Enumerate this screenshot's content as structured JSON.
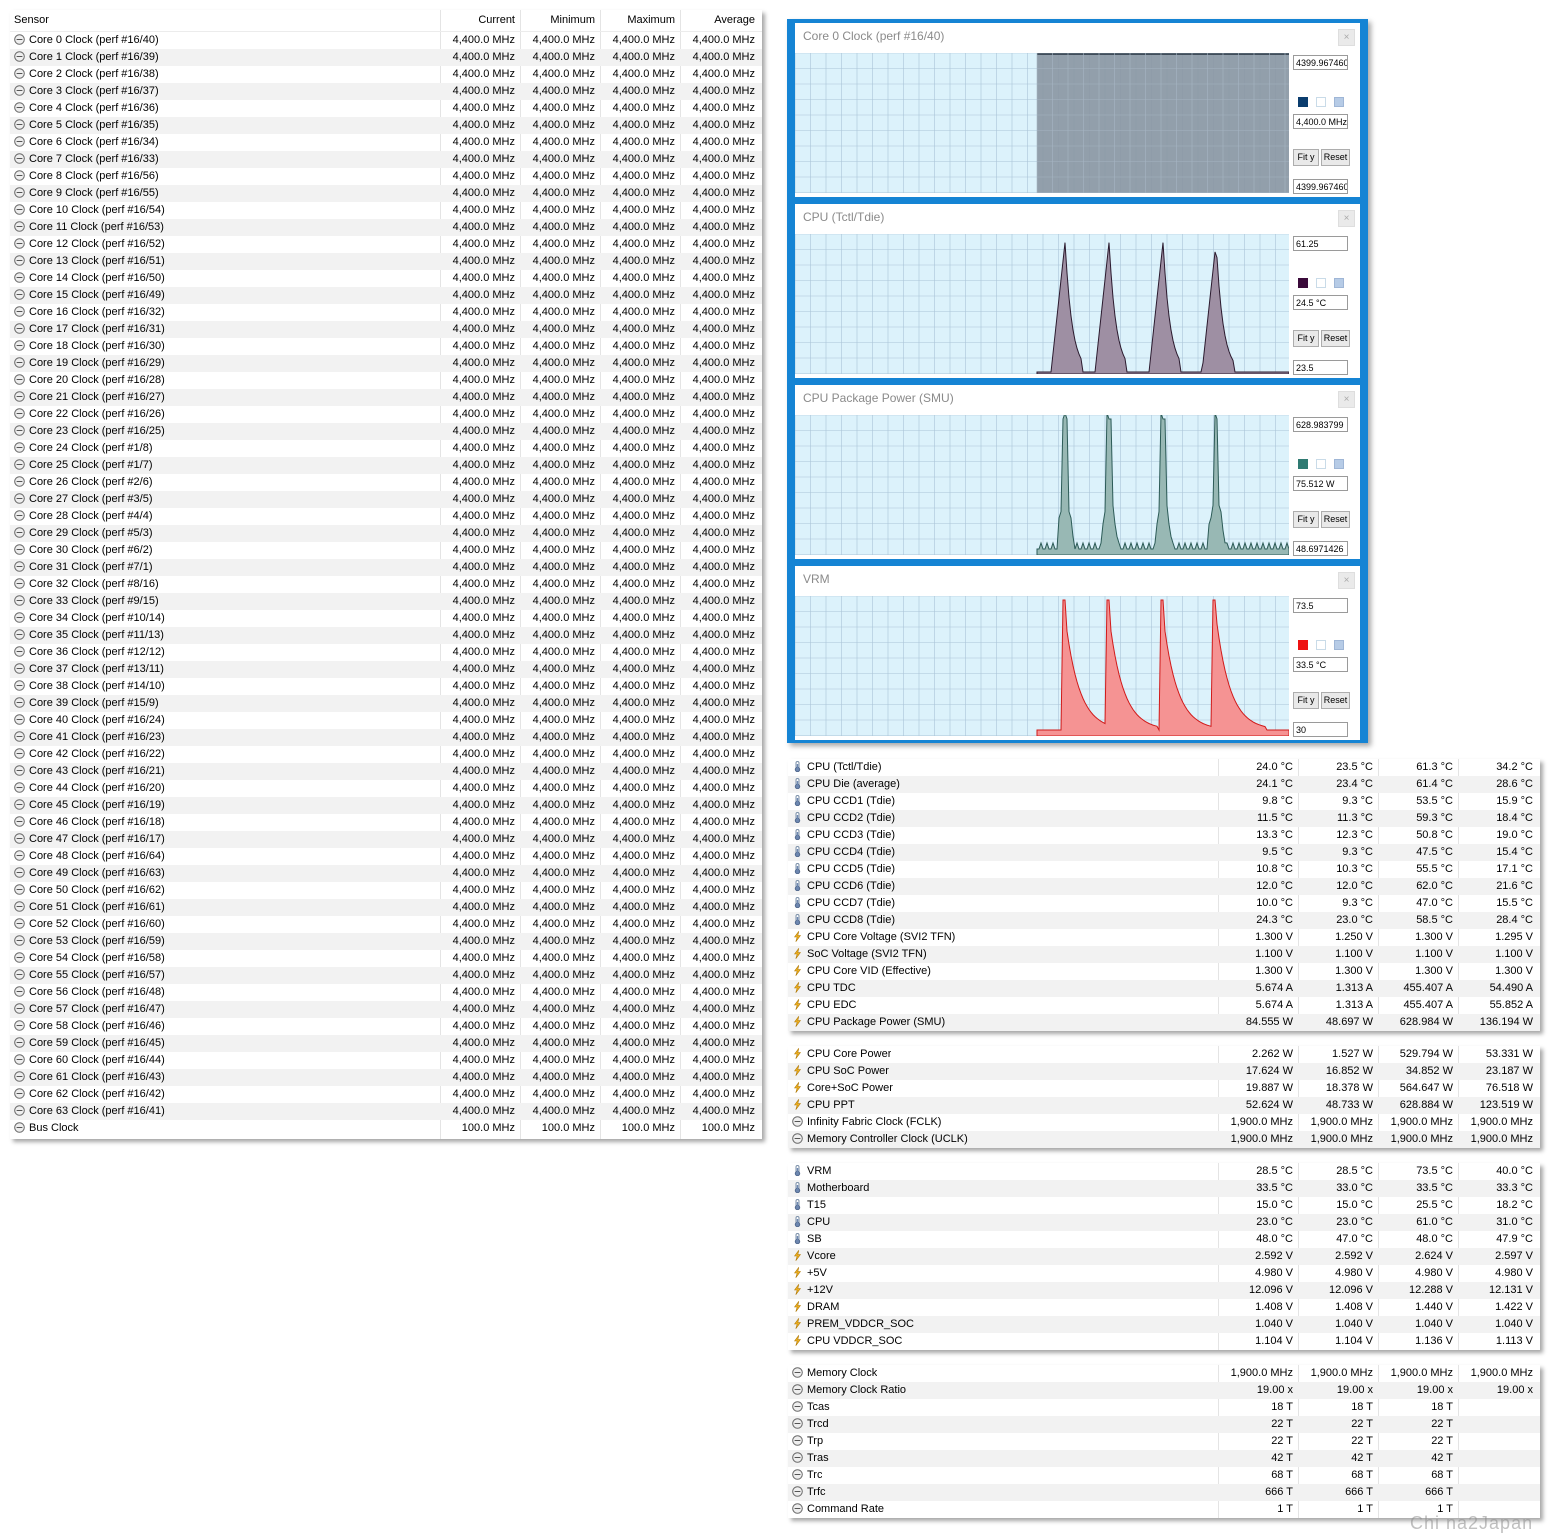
{
  "left_table": {
    "headers": [
      "Sensor",
      "Current",
      "Minimum",
      "Maximum",
      "Average"
    ],
    "rows": [
      [
        "Core 0 Clock (perf #16/40)",
        "4,400.0 MHz",
        "4,400.0 MHz",
        "4,400.0 MHz",
        "4,400.0 MHz"
      ],
      [
        "Core 1 Clock (perf #16/39)",
        "4,400.0 MHz",
        "4,400.0 MHz",
        "4,400.0 MHz",
        "4,400.0 MHz"
      ],
      [
        "Core 2 Clock (perf #16/38)",
        "4,400.0 MHz",
        "4,400.0 MHz",
        "4,400.0 MHz",
        "4,400.0 MHz"
      ],
      [
        "Core 3 Clock (perf #16/37)",
        "4,400.0 MHz",
        "4,400.0 MHz",
        "4,400.0 MHz",
        "4,400.0 MHz"
      ],
      [
        "Core 4 Clock (perf #16/36)",
        "4,400.0 MHz",
        "4,400.0 MHz",
        "4,400.0 MHz",
        "4,400.0 MHz"
      ],
      [
        "Core 5 Clock (perf #16/35)",
        "4,400.0 MHz",
        "4,400.0 MHz",
        "4,400.0 MHz",
        "4,400.0 MHz"
      ],
      [
        "Core 6 Clock (perf #16/34)",
        "4,400.0 MHz",
        "4,400.0 MHz",
        "4,400.0 MHz",
        "4,400.0 MHz"
      ],
      [
        "Core 7 Clock (perf #16/33)",
        "4,400.0 MHz",
        "4,400.0 MHz",
        "4,400.0 MHz",
        "4,400.0 MHz"
      ],
      [
        "Core 8 Clock (perf #16/56)",
        "4,400.0 MHz",
        "4,400.0 MHz",
        "4,400.0 MHz",
        "4,400.0 MHz"
      ],
      [
        "Core 9 Clock (perf #16/55)",
        "4,400.0 MHz",
        "4,400.0 MHz",
        "4,400.0 MHz",
        "4,400.0 MHz"
      ],
      [
        "Core 10 Clock (perf #16/54)",
        "4,400.0 MHz",
        "4,400.0 MHz",
        "4,400.0 MHz",
        "4,400.0 MHz"
      ],
      [
        "Core 11 Clock (perf #16/53)",
        "4,400.0 MHz",
        "4,400.0 MHz",
        "4,400.0 MHz",
        "4,400.0 MHz"
      ],
      [
        "Core 12 Clock (perf #16/52)",
        "4,400.0 MHz",
        "4,400.0 MHz",
        "4,400.0 MHz",
        "4,400.0 MHz"
      ],
      [
        "Core 13 Clock (perf #16/51)",
        "4,400.0 MHz",
        "4,400.0 MHz",
        "4,400.0 MHz",
        "4,400.0 MHz"
      ],
      [
        "Core 14 Clock (perf #16/50)",
        "4,400.0 MHz",
        "4,400.0 MHz",
        "4,400.0 MHz",
        "4,400.0 MHz"
      ],
      [
        "Core 15 Clock (perf #16/49)",
        "4,400.0 MHz",
        "4,400.0 MHz",
        "4,400.0 MHz",
        "4,400.0 MHz"
      ],
      [
        "Core 16 Clock (perf #16/32)",
        "4,400.0 MHz",
        "4,400.0 MHz",
        "4,400.0 MHz",
        "4,400.0 MHz"
      ],
      [
        "Core 17 Clock (perf #16/31)",
        "4,400.0 MHz",
        "4,400.0 MHz",
        "4,400.0 MHz",
        "4,400.0 MHz"
      ],
      [
        "Core 18 Clock (perf #16/30)",
        "4,400.0 MHz",
        "4,400.0 MHz",
        "4,400.0 MHz",
        "4,400.0 MHz"
      ],
      [
        "Core 19 Clock (perf #16/29)",
        "4,400.0 MHz",
        "4,400.0 MHz",
        "4,400.0 MHz",
        "4,400.0 MHz"
      ],
      [
        "Core 20 Clock (perf #16/28)",
        "4,400.0 MHz",
        "4,400.0 MHz",
        "4,400.0 MHz",
        "4,400.0 MHz"
      ],
      [
        "Core 21 Clock (perf #16/27)",
        "4,400.0 MHz",
        "4,400.0 MHz",
        "4,400.0 MHz",
        "4,400.0 MHz"
      ],
      [
        "Core 22 Clock (perf #16/26)",
        "4,400.0 MHz",
        "4,400.0 MHz",
        "4,400.0 MHz",
        "4,400.0 MHz"
      ],
      [
        "Core 23 Clock (perf #16/25)",
        "4,400.0 MHz",
        "4,400.0 MHz",
        "4,400.0 MHz",
        "4,400.0 MHz"
      ],
      [
        "Core 24 Clock (perf #1/8)",
        "4,400.0 MHz",
        "4,400.0 MHz",
        "4,400.0 MHz",
        "4,400.0 MHz"
      ],
      [
        "Core 25 Clock (perf #1/7)",
        "4,400.0 MHz",
        "4,400.0 MHz",
        "4,400.0 MHz",
        "4,400.0 MHz"
      ],
      [
        "Core 26 Clock (perf #2/6)",
        "4,400.0 MHz",
        "4,400.0 MHz",
        "4,400.0 MHz",
        "4,400.0 MHz"
      ],
      [
        "Core 27 Clock (perf #3/5)",
        "4,400.0 MHz",
        "4,400.0 MHz",
        "4,400.0 MHz",
        "4,400.0 MHz"
      ],
      [
        "Core 28 Clock (perf #4/4)",
        "4,400.0 MHz",
        "4,400.0 MHz",
        "4,400.0 MHz",
        "4,400.0 MHz"
      ],
      [
        "Core 29 Clock (perf #5/3)",
        "4,400.0 MHz",
        "4,400.0 MHz",
        "4,400.0 MHz",
        "4,400.0 MHz"
      ],
      [
        "Core 30 Clock (perf #6/2)",
        "4,400.0 MHz",
        "4,400.0 MHz",
        "4,400.0 MHz",
        "4,400.0 MHz"
      ],
      [
        "Core 31 Clock (perf #7/1)",
        "4,400.0 MHz",
        "4,400.0 MHz",
        "4,400.0 MHz",
        "4,400.0 MHz"
      ],
      [
        "Core 32 Clock (perf #8/16)",
        "4,400.0 MHz",
        "4,400.0 MHz",
        "4,400.0 MHz",
        "4,400.0 MHz"
      ],
      [
        "Core 33 Clock (perf #9/15)",
        "4,400.0 MHz",
        "4,400.0 MHz",
        "4,400.0 MHz",
        "4,400.0 MHz"
      ],
      [
        "Core 34 Clock (perf #10/14)",
        "4,400.0 MHz",
        "4,400.0 MHz",
        "4,400.0 MHz",
        "4,400.0 MHz"
      ],
      [
        "Core 35 Clock (perf #11/13)",
        "4,400.0 MHz",
        "4,400.0 MHz",
        "4,400.0 MHz",
        "4,400.0 MHz"
      ],
      [
        "Core 36 Clock (perf #12/12)",
        "4,400.0 MHz",
        "4,400.0 MHz",
        "4,400.0 MHz",
        "4,400.0 MHz"
      ],
      [
        "Core 37 Clock (perf #13/11)",
        "4,400.0 MHz",
        "4,400.0 MHz",
        "4,400.0 MHz",
        "4,400.0 MHz"
      ],
      [
        "Core 38 Clock (perf #14/10)",
        "4,400.0 MHz",
        "4,400.0 MHz",
        "4,400.0 MHz",
        "4,400.0 MHz"
      ],
      [
        "Core 39 Clock (perf #15/9)",
        "4,400.0 MHz",
        "4,400.0 MHz",
        "4,400.0 MHz",
        "4,400.0 MHz"
      ],
      [
        "Core 40 Clock (perf #16/24)",
        "4,400.0 MHz",
        "4,400.0 MHz",
        "4,400.0 MHz",
        "4,400.0 MHz"
      ],
      [
        "Core 41 Clock (perf #16/23)",
        "4,400.0 MHz",
        "4,400.0 MHz",
        "4,400.0 MHz",
        "4,400.0 MHz"
      ],
      [
        "Core 42 Clock (perf #16/22)",
        "4,400.0 MHz",
        "4,400.0 MHz",
        "4,400.0 MHz",
        "4,400.0 MHz"
      ],
      [
        "Core 43 Clock (perf #16/21)",
        "4,400.0 MHz",
        "4,400.0 MHz",
        "4,400.0 MHz",
        "4,400.0 MHz"
      ],
      [
        "Core 44 Clock (perf #16/20)",
        "4,400.0 MHz",
        "4,400.0 MHz",
        "4,400.0 MHz",
        "4,400.0 MHz"
      ],
      [
        "Core 45 Clock (perf #16/19)",
        "4,400.0 MHz",
        "4,400.0 MHz",
        "4,400.0 MHz",
        "4,400.0 MHz"
      ],
      [
        "Core 46 Clock (perf #16/18)",
        "4,400.0 MHz",
        "4,400.0 MHz",
        "4,400.0 MHz",
        "4,400.0 MHz"
      ],
      [
        "Core 47 Clock (perf #16/17)",
        "4,400.0 MHz",
        "4,400.0 MHz",
        "4,400.0 MHz",
        "4,400.0 MHz"
      ],
      [
        "Core 48 Clock (perf #16/64)",
        "4,400.0 MHz",
        "4,400.0 MHz",
        "4,400.0 MHz",
        "4,400.0 MHz"
      ],
      [
        "Core 49 Clock (perf #16/63)",
        "4,400.0 MHz",
        "4,400.0 MHz",
        "4,400.0 MHz",
        "4,400.0 MHz"
      ],
      [
        "Core 50 Clock (perf #16/62)",
        "4,400.0 MHz",
        "4,400.0 MHz",
        "4,400.0 MHz",
        "4,400.0 MHz"
      ],
      [
        "Core 51 Clock (perf #16/61)",
        "4,400.0 MHz",
        "4,400.0 MHz",
        "4,400.0 MHz",
        "4,400.0 MHz"
      ],
      [
        "Core 52 Clock (perf #16/60)",
        "4,400.0 MHz",
        "4,400.0 MHz",
        "4,400.0 MHz",
        "4,400.0 MHz"
      ],
      [
        "Core 53 Clock (perf #16/59)",
        "4,400.0 MHz",
        "4,400.0 MHz",
        "4,400.0 MHz",
        "4,400.0 MHz"
      ],
      [
        "Core 54 Clock (perf #16/58)",
        "4,400.0 MHz",
        "4,400.0 MHz",
        "4,400.0 MHz",
        "4,400.0 MHz"
      ],
      [
        "Core 55 Clock (perf #16/57)",
        "4,400.0 MHz",
        "4,400.0 MHz",
        "4,400.0 MHz",
        "4,400.0 MHz"
      ],
      [
        "Core 56 Clock (perf #16/48)",
        "4,400.0 MHz",
        "4,400.0 MHz",
        "4,400.0 MHz",
        "4,400.0 MHz"
      ],
      [
        "Core 57 Clock (perf #16/47)",
        "4,400.0 MHz",
        "4,400.0 MHz",
        "4,400.0 MHz",
        "4,400.0 MHz"
      ],
      [
        "Core 58 Clock (perf #16/46)",
        "4,400.0 MHz",
        "4,400.0 MHz",
        "4,400.0 MHz",
        "4,400.0 MHz"
      ],
      [
        "Core 59 Clock (perf #16/45)",
        "4,400.0 MHz",
        "4,400.0 MHz",
        "4,400.0 MHz",
        "4,400.0 MHz"
      ],
      [
        "Core 60 Clock (perf #16/44)",
        "4,400.0 MHz",
        "4,400.0 MHz",
        "4,400.0 MHz",
        "4,400.0 MHz"
      ],
      [
        "Core 61 Clock (perf #16/43)",
        "4,400.0 MHz",
        "4,400.0 MHz",
        "4,400.0 MHz",
        "4,400.0 MHz"
      ],
      [
        "Core 62 Clock (perf #16/42)",
        "4,400.0 MHz",
        "4,400.0 MHz",
        "4,400.0 MHz",
        "4,400.0 MHz"
      ],
      [
        "Core 63 Clock (perf #16/41)",
        "4,400.0 MHz",
        "4,400.0 MHz",
        "4,400.0 MHz",
        "4,400.0 MHz"
      ],
      [
        "Bus Clock",
        "100.0 MHz",
        "100.0 MHz",
        "100.0 MHz",
        "100.0 MHz"
      ]
    ]
  },
  "graphs": [
    {
      "title": "Core 0 Clock (perf #16/40)",
      "top_value": "4399.967460",
      "current_value": "4,400.0 MHz",
      "bottom_value": "4399.967460",
      "color": "#0b3d6e",
      "fit_label": "Fit y",
      "reset_label": "Reset"
    },
    {
      "title": "CPU (Tctl/Tdie)",
      "top_value": "61.25",
      "current_value": "24.5 °C",
      "bottom_value": "23.5",
      "color": "#3a0a3a",
      "fit_label": "Fit y",
      "reset_label": "Reset"
    },
    {
      "title": "CPU Package Power (SMU)",
      "top_value": "628.983799",
      "current_value": "75.512 W",
      "bottom_value": "48.6971426",
      "color": "#2f7a72",
      "fit_label": "Fit y",
      "reset_label": "Reset"
    },
    {
      "title": "VRM",
      "top_value": "73.5",
      "current_value": "33.5 °C",
      "bottom_value": "30",
      "color": "#ee1111",
      "fit_label": "Fit y",
      "reset_label": "Reset"
    }
  ],
  "right_groups": [
    {
      "rows": [
        [
          "temp",
          "CPU (Tctl/Tdie)",
          "24.0 °C",
          "23.5 °C",
          "61.3 °C",
          "34.2 °C"
        ],
        [
          "temp",
          "CPU Die (average)",
          "24.1 °C",
          "23.4 °C",
          "61.4 °C",
          "28.6 °C"
        ],
        [
          "temp",
          "CPU CCD1 (Tdie)",
          "9.8 °C",
          "9.3 °C",
          "53.5 °C",
          "15.9 °C"
        ],
        [
          "temp",
          "CPU CCD2 (Tdie)",
          "11.5 °C",
          "11.3 °C",
          "59.3 °C",
          "18.4 °C"
        ],
        [
          "temp",
          "CPU CCD3 (Tdie)",
          "13.3 °C",
          "12.3 °C",
          "50.8 °C",
          "19.0 °C"
        ],
        [
          "temp",
          "CPU CCD4 (Tdie)",
          "9.5 °C",
          "9.3 °C",
          "47.5 °C",
          "15.4 °C"
        ],
        [
          "temp",
          "CPU CCD5 (Tdie)",
          "10.8 °C",
          "10.3 °C",
          "55.5 °C",
          "17.1 °C"
        ],
        [
          "temp",
          "CPU CCD6 (Tdie)",
          "12.0 °C",
          "12.0 °C",
          "62.0 °C",
          "21.6 °C"
        ],
        [
          "temp",
          "CPU CCD7 (Tdie)",
          "10.0 °C",
          "9.3 °C",
          "47.0 °C",
          "15.5 °C"
        ],
        [
          "temp",
          "CPU CCD8 (Tdie)",
          "24.3 °C",
          "23.0 °C",
          "58.5 °C",
          "28.4 °C"
        ],
        [
          "bolt",
          "CPU Core Voltage (SVI2 TFN)",
          "1.300 V",
          "1.250 V",
          "1.300 V",
          "1.295 V"
        ],
        [
          "bolt",
          "SoC Voltage (SVI2 TFN)",
          "1.100 V",
          "1.100 V",
          "1.100 V",
          "1.100 V"
        ],
        [
          "bolt",
          "CPU Core VID (Effective)",
          "1.300 V",
          "1.300 V",
          "1.300 V",
          "1.300 V"
        ],
        [
          "bolt",
          "CPU TDC",
          "5.674 A",
          "1.313 A",
          "455.407 A",
          "54.490 A"
        ],
        [
          "bolt",
          "CPU EDC",
          "5.674 A",
          "1.313 A",
          "455.407 A",
          "55.852 A"
        ],
        [
          "bolt",
          "CPU Package Power (SMU)",
          "84.555 W",
          "48.697 W",
          "628.984 W",
          "136.194 W"
        ]
      ]
    },
    {
      "rows": [
        [
          "bolt",
          "CPU Core Power",
          "2.262 W",
          "1.527 W",
          "529.794 W",
          "53.331 W"
        ],
        [
          "bolt",
          "CPU SoC Power",
          "17.624 W",
          "16.852 W",
          "34.852 W",
          "23.187 W"
        ],
        [
          "bolt",
          "Core+SoC Power",
          "19.887 W",
          "18.378 W",
          "564.647 W",
          "76.518 W"
        ],
        [
          "bolt",
          "CPU PPT",
          "52.624 W",
          "48.733 W",
          "628.884 W",
          "123.519 W"
        ],
        [
          "clock",
          "Infinity Fabric Clock (FCLK)",
          "1,900.0 MHz",
          "1,900.0 MHz",
          "1,900.0 MHz",
          "1,900.0 MHz"
        ],
        [
          "clock",
          "Memory Controller Clock (UCLK)",
          "1,900.0 MHz",
          "1,900.0 MHz",
          "1,900.0 MHz",
          "1,900.0 MHz"
        ]
      ]
    },
    {
      "rows": [
        [
          "temp",
          "VRM",
          "28.5 °C",
          "28.5 °C",
          "73.5 °C",
          "40.0 °C"
        ],
        [
          "temp",
          "Motherboard",
          "33.5 °C",
          "33.0 °C",
          "33.5 °C",
          "33.3 °C"
        ],
        [
          "temp",
          "T15",
          "15.0 °C",
          "15.0 °C",
          "25.5 °C",
          "18.2 °C"
        ],
        [
          "temp",
          "CPU",
          "23.0 °C",
          "23.0 °C",
          "61.0 °C",
          "31.0 °C"
        ],
        [
          "temp",
          "SB",
          "48.0 °C",
          "47.0 °C",
          "48.0 °C",
          "47.9 °C"
        ],
        [
          "bolt",
          "Vcore",
          "2.592 V",
          "2.592 V",
          "2.624 V",
          "2.597 V"
        ],
        [
          "bolt",
          "+5V",
          "4.980 V",
          "4.980 V",
          "4.980 V",
          "4.980 V"
        ],
        [
          "bolt",
          "+12V",
          "12.096 V",
          "12.096 V",
          "12.288 V",
          "12.131 V"
        ],
        [
          "bolt",
          "DRAM",
          "1.408 V",
          "1.408 V",
          "1.440 V",
          "1.422 V"
        ],
        [
          "bolt",
          "PREM_VDDCR_SOC",
          "1.040 V",
          "1.040 V",
          "1.040 V",
          "1.040 V"
        ],
        [
          "bolt",
          "CPU VDDCR_SOC",
          "1.104 V",
          "1.104 V",
          "1.136 V",
          "1.113 V"
        ]
      ]
    },
    {
      "rows": [
        [
          "clock",
          "Memory Clock",
          "1,900.0 MHz",
          "1,900.0 MHz",
          "1,900.0 MHz",
          "1,900.0 MHz"
        ],
        [
          "clock",
          "Memory Clock Ratio",
          "19.00 x",
          "19.00 x",
          "19.00 x",
          "19.00 x"
        ],
        [
          "clock",
          "Tcas",
          "18 T",
          "18 T",
          "18 T",
          ""
        ],
        [
          "clock",
          "Trcd",
          "22 T",
          "22 T",
          "22 T",
          ""
        ],
        [
          "clock",
          "Trp",
          "22 T",
          "22 T",
          "22 T",
          ""
        ],
        [
          "clock",
          "Tras",
          "42 T",
          "42 T",
          "42 T",
          ""
        ],
        [
          "clock",
          "Trc",
          "68 T",
          "68 T",
          "68 T",
          ""
        ],
        [
          "clock",
          "Trfc",
          "666 T",
          "666 T",
          "666 T",
          ""
        ],
        [
          "clock",
          "Command Rate",
          "1 T",
          "1 T",
          "1 T",
          ""
        ]
      ]
    }
  ],
  "watermark": "Chi  na2Japan"
}
